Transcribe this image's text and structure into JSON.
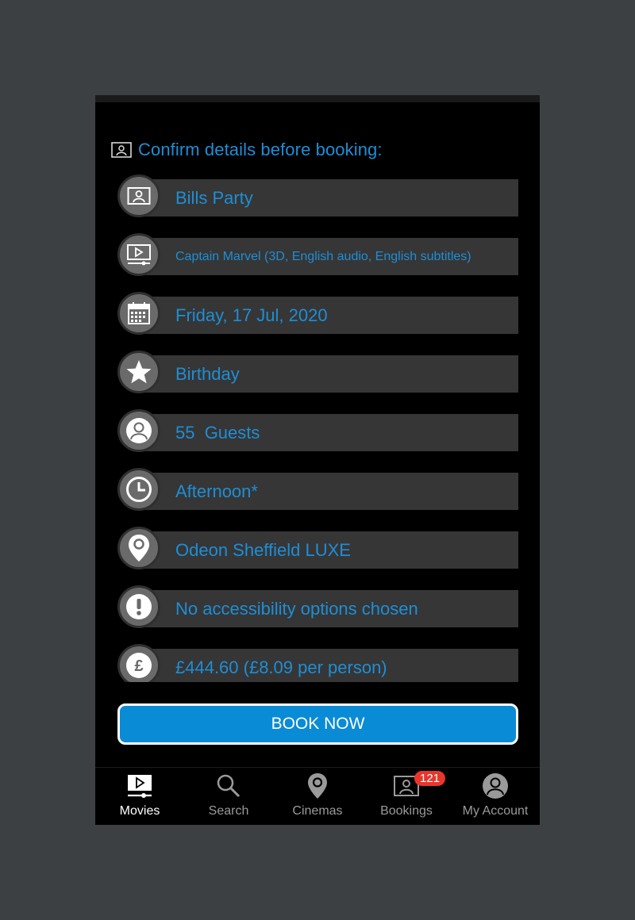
{
  "header": {
    "title": "Confirm details before booking:",
    "icon": "ticket-icon"
  },
  "details": [
    {
      "name": "party-name",
      "icon": "ticket-icon",
      "label": "Bills Party"
    },
    {
      "name": "movie",
      "icon": "movie-icon",
      "label": "Captain Marvel (3D, English audio, English subtitles)"
    },
    {
      "name": "date",
      "icon": "calendar-icon",
      "label": "Friday, 17 Jul, 2020"
    },
    {
      "name": "occasion",
      "icon": "star-icon",
      "label": "Birthday"
    },
    {
      "name": "guests",
      "icon": "person-icon",
      "label": "55  Guests"
    },
    {
      "name": "time",
      "icon": "clock-icon",
      "label": "Afternoon*"
    },
    {
      "name": "cinema",
      "icon": "location-pin-icon",
      "label": "Odeon Sheffield LUXE"
    },
    {
      "name": "accessibility",
      "icon": "exclamation-icon",
      "label": "No accessibility options chosen"
    },
    {
      "name": "price",
      "icon": "pound-icon",
      "label": "£444.60 (£8.09 per person)"
    }
  ],
  "book_button": {
    "label": "BOOK NOW"
  },
  "tabs": [
    {
      "label": "Movies",
      "icon": "movie-icon",
      "active": true
    },
    {
      "label": "Search",
      "icon": "search-icon"
    },
    {
      "label": "Cinemas",
      "icon": "location-pin-icon"
    },
    {
      "label": "Bookings",
      "icon": "ticket-icon",
      "badge": "121"
    },
    {
      "label": "My Account",
      "icon": "person-icon"
    }
  ],
  "colors": {
    "accent": "#1e8ed6",
    "button": "#0a8bd6",
    "badge": "#e8362c",
    "row_bar": "#363636",
    "icon_circle": "#6a6a6a"
  }
}
